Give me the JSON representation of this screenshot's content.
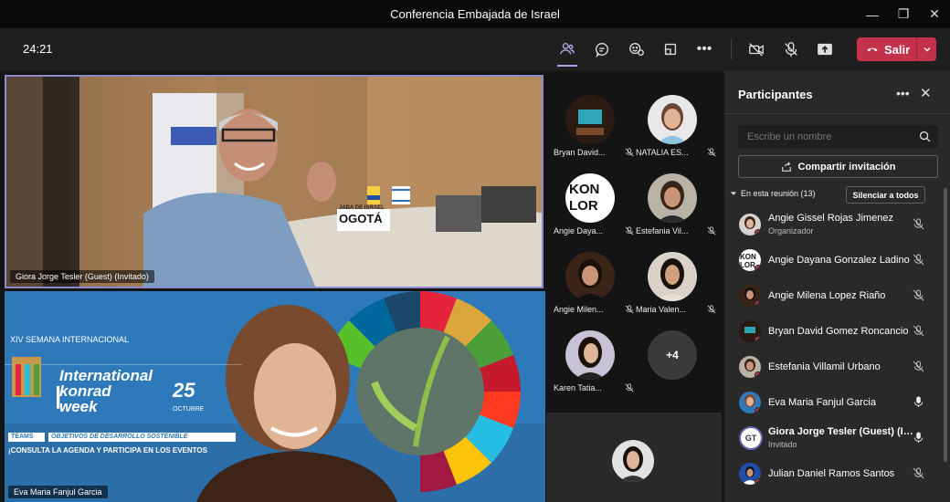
{
  "window": {
    "title": "Conferencia Embajada de Israel"
  },
  "toolbar": {
    "timer": "24:21",
    "leave_label": "Salir"
  },
  "stage": {
    "main_video_name": "Giora Jorge Tesler (Guest) (Invitado)",
    "second_video_name": "Eva Maria Fanjul Garcia",
    "banner_line1": "XIV SEMANA INTERNACIONAL",
    "banner_brand": "International konrad week",
    "banner_date": "25",
    "banner_month": "OCTUBRE",
    "banner_tag": "TEAMS",
    "banner_obj": "OBJETIVOS DE DESARROLLO SOSTENIBLE",
    "banner_cta": "¡CONSULTA LA AGENDA Y PARTICIPA EN LOS EVENTOS",
    "sign_text": "OGOTÁ",
    "sign_top": "JADA DE ISRAEL"
  },
  "gallery": {
    "tiles": [
      {
        "name": "Bryan David..."
      },
      {
        "name": "NATALIA ES..."
      },
      {
        "name": "Angie Daya..."
      },
      {
        "name": "Estefania Vil..."
      },
      {
        "name": "Angie Milen..."
      },
      {
        "name": "Maria Valen..."
      },
      {
        "name": "Karen Tatia..."
      }
    ],
    "more_label": "+4"
  },
  "panel": {
    "title": "Participantes",
    "search_placeholder": "Escribe un nombre",
    "share_label": "Compartir invitación",
    "section_label": "En esta reunión (13)",
    "mute_all_label": "Silenciar a todos",
    "participants": [
      {
        "name": "Angie Gissel Rojas Jimenez",
        "role": "Organizador"
      },
      {
        "name": "Angie Dayana Gonzalez Ladino"
      },
      {
        "name": "Angie Milena Lopez Riaño"
      },
      {
        "name": "Bryan David Gomez Roncancio"
      },
      {
        "name": "Estefania Villamil Urbano"
      },
      {
        "name": "Eva Maria Fanjul Garcia"
      },
      {
        "name": "Giora Jorge Tesler (Guest) (In...",
        "role": "Invitado",
        "initials": "GT"
      },
      {
        "name": "Julian Daniel Ramos Santos"
      }
    ]
  },
  "colors": {
    "accent": "#6264a7",
    "leave": "#c4314b",
    "panel": "#292929"
  }
}
